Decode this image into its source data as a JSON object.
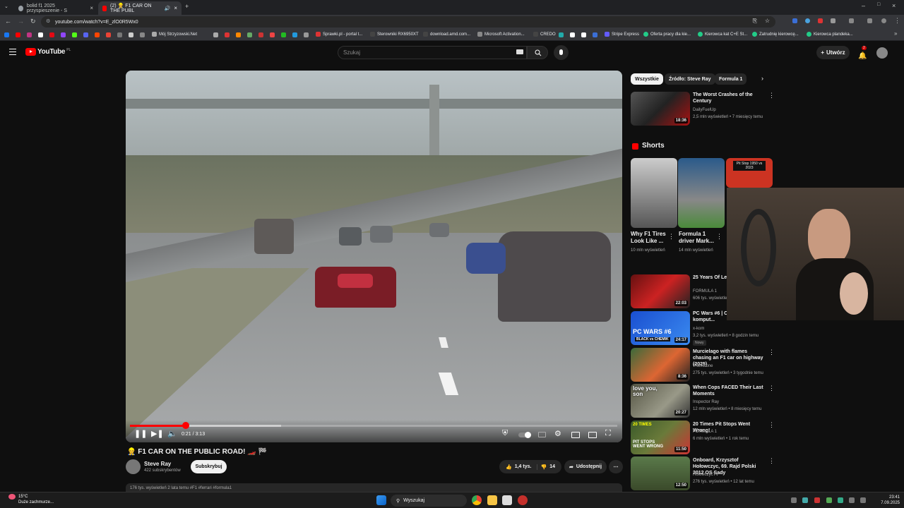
{
  "browser": {
    "tabs": [
      {
        "title": "bolid f1 2025 przyspieszenie - S",
        "active": false
      },
      {
        "title": "(2) 👷 F1 CAR ON THE PUBL",
        "active": true
      }
    ],
    "url": "youtube.com/watch?v=E_zlO0R5Wx0",
    "bookmarks": [
      "Mój Strzyzowski.Net",
      "Sprawki.pl - portal t...",
      "Sterowniki RX6950XT",
      "download.amd.com...",
      "Microsoft Activation...",
      "CREDO",
      "Stripe Express",
      "Oferta pracy dla kie...",
      "Kierowca kat C+E St...",
      "Zatrudnię kierowcę...",
      "Kierowca plandeka..."
    ]
  },
  "youtube": {
    "logo_text": "YouTube",
    "logo_region": "PL",
    "search_placeholder": "Szukaj",
    "create_label": "Utwórz",
    "notification_count": "2"
  },
  "player": {
    "time_display": "0:21 / 3:13",
    "progress_fraction": 0.115,
    "buffered_fraction": 0.31
  },
  "video": {
    "title": "👷 F1 CAR ON THE PUBLIC ROAD! 🏎️ 🏁",
    "channel": "Steve Ray",
    "subscribers": "422 subskrybentów",
    "subscribe_label": "Subskrybuj",
    "likes": "1,4 tys.",
    "dislikes": "14",
    "share_label": "Udostępnij",
    "description_snippet": "176 tys. wyświetleń  2 lata temu  #F1 #ferrari #formula1"
  },
  "chips": [
    "Wszystkie",
    "Źródło: Steve Ray",
    "Formula 1"
  ],
  "shorts_heading": "Shorts",
  "shorts": [
    {
      "title": "Why F1 Tires Look Like ...",
      "meta": "10 mln wyświetleń"
    },
    {
      "title": "Formula 1 driver Mark...",
      "meta": "14 mln wyświetleń"
    },
    {
      "overlay": "Pit Stop 1950 vs 2023"
    }
  ],
  "recommended": [
    {
      "title": "The Worst Crashes of the Century",
      "channel": "DailyFuelUp",
      "meta": "2,5 mln wyświetleń • 7 miesięcy temu",
      "duration": "18:36"
    },
    {
      "title": "25 Years Of Le... Radio",
      "channel": "FORMULA 1",
      "meta": "606 tys. wyświetleń",
      "duration": "22:03"
    },
    {
      "title": "PC Wars #6 | CHEMIK komput...",
      "channel": "x-kom",
      "meta": "3,2 tys. wyświetleń • 8 godzin temu",
      "duration": "24:17",
      "badge": "Nowy"
    },
    {
      "title": "Murcielago with flames chasing an F1 car on highway (2025)",
      "channel": "TrackZone",
      "meta": "275 tys. wyświetleń • 3 tygodnie temu",
      "duration": "8:36"
    },
    {
      "title": "When Cops FACED Their Last Moments",
      "channel": "Inspector Ray",
      "meta": "12 mln wyświetleń • 8 miesięcy temu",
      "duration": "20:27"
    },
    {
      "title": "20 Times Pit Stops Went Wrong!",
      "channel": "FORMULA 1",
      "meta": "6 mln wyświetleń • 1 rok temu",
      "duration": "11:50"
    },
    {
      "title": "Onboard, Krzysztof Hołowczyc, 69. Rajd Polski 2012 OS Sady",
      "channel": "HolowczycTV",
      "meta": "276 tys. wyświetleń • 12 lat temu",
      "duration": "12:50"
    }
  ],
  "thumb_overlays": {
    "pc_wars": "PC WARS #6",
    "pc_wars_sub": "BLACK vs CHEMIK",
    "pit_stops": "PIT STOPS WENT WRONG",
    "twenty": "20 TIMES",
    "love_you": "love you, son"
  },
  "taskbar": {
    "weather_temp": "15°C",
    "weather_desc": "Duże zachmurze...",
    "search_label": "Wyszukaj",
    "time": "23:41",
    "date": "7.09.2025"
  },
  "colors": {
    "accent": "#ff0000",
    "background": "#0f0f0f",
    "chip_bg": "#272727"
  }
}
